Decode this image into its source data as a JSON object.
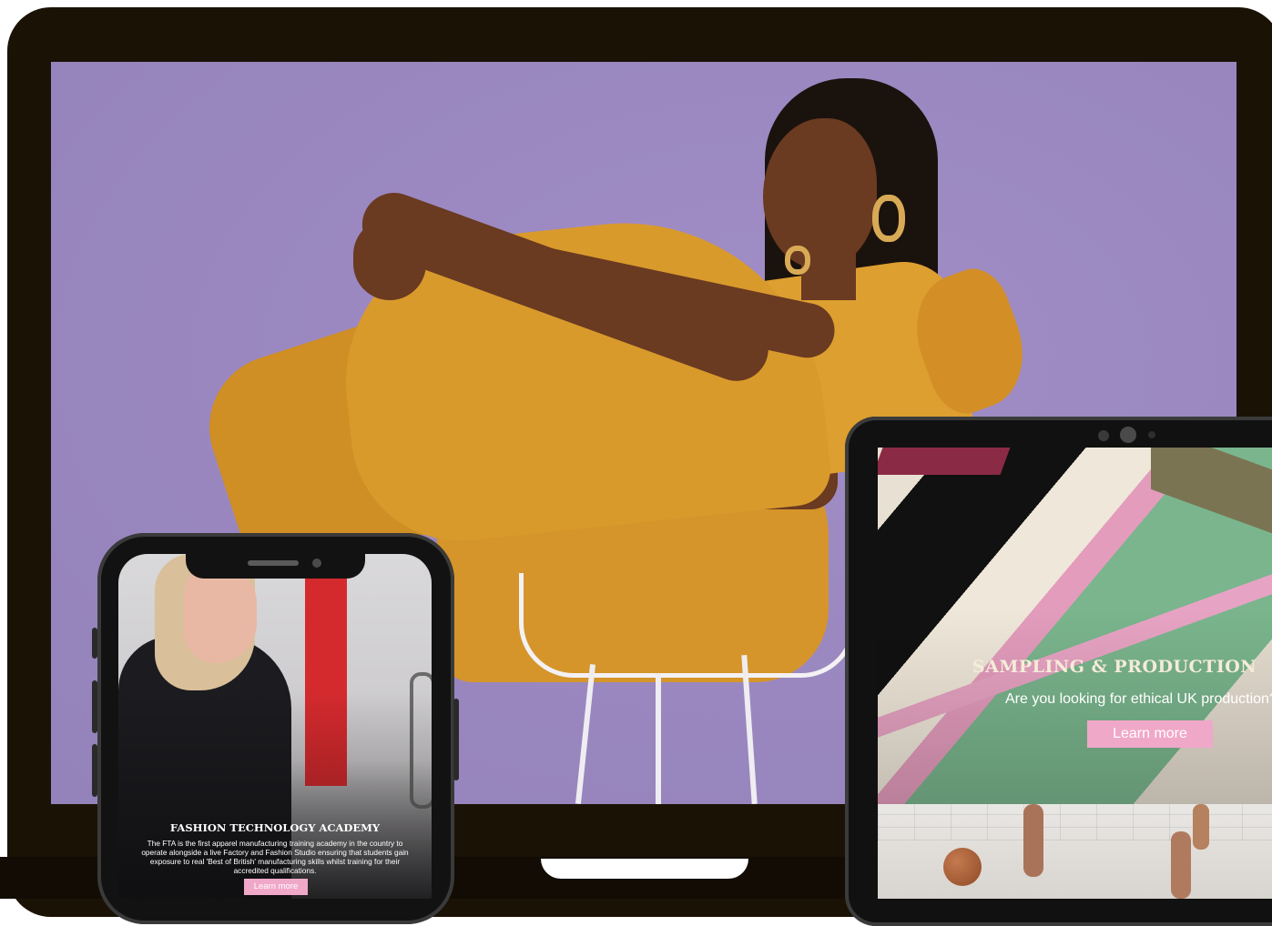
{
  "tablet": {
    "hero_title": "SAMPLING & PRODUCTION",
    "hero_text": "Are you looking for ethical UK production?",
    "button_label": "Learn more"
  },
  "phone": {
    "hero_title": "FASHION TECHNOLOGY ACADEMY",
    "hero_text": "The FTA is the first apparel manufacturing training academy in the country to operate alongside a live Factory and Fashion Studio ensuring that students gain exposure to real 'Best of British' manufacturing skills whilst training for their accredited qualifications.",
    "button_label": "Learn more"
  },
  "colors": {
    "accent_pink": "#f0a8c8",
    "laptop_frame": "#1b1206",
    "hero_background": "#9b88c1"
  }
}
